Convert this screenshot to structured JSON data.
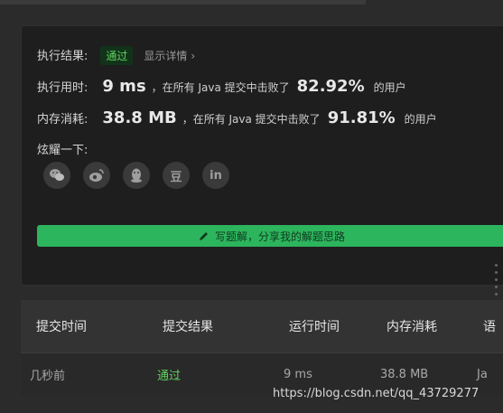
{
  "result": {
    "label": "执行结果:",
    "status": "通过",
    "detail_link": "显示详情",
    "detail_chevron": "›"
  },
  "runtime": {
    "label": "执行用时:",
    "value": "9 ms",
    "text": "，在所有 Java 提交中击败了",
    "percent": "82.92%",
    "suffix": "的用户"
  },
  "memory": {
    "label": "内存消耗:",
    "value": "38.8 MB",
    "text": "，在所有 Java 提交中击败了",
    "percent": "91.81%",
    "suffix": "的用户"
  },
  "share": {
    "label": "炫耀一下:",
    "icons": [
      "wechat-icon",
      "weibo-icon",
      "qq-icon",
      "douban-icon",
      "linkedin-icon"
    ],
    "douban_glyph": "豆",
    "linkedin_glyph": "in"
  },
  "write_solution": {
    "label": "写题解，分享我的解题思路"
  },
  "table": {
    "headers": [
      "提交时间",
      "提交结果",
      "运行时间",
      "内存消耗",
      "语"
    ],
    "rows": [
      {
        "time": "几秒前",
        "result": "通过",
        "runtime": "9 ms",
        "memory": "38.8 MB",
        "language": "Ja"
      }
    ]
  },
  "watermark": "https://blog.csdn.net/qq_43729277",
  "colors": {
    "accent": "#2db55d",
    "pass": "#5fd35f",
    "background": "#2b2b2b",
    "card": "#1e1e1e"
  }
}
